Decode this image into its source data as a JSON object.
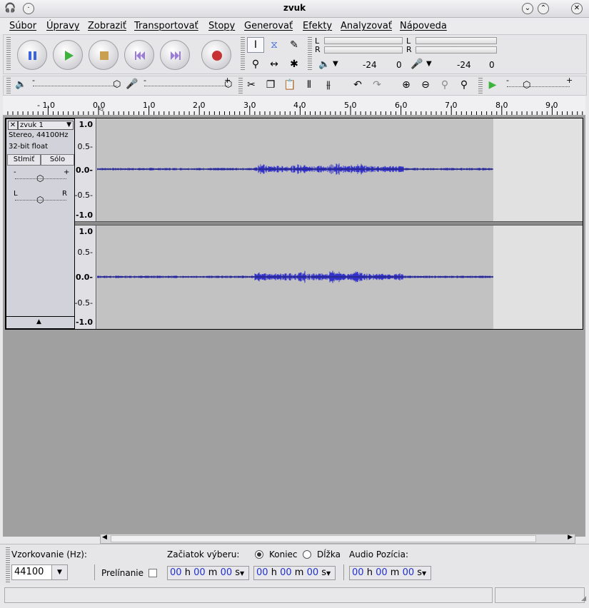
{
  "window": {
    "title": "zvuk"
  },
  "menu": [
    "Súbor",
    "Úpravy",
    "Zobraziť",
    "Transportovať",
    "Stopy",
    "Generovať",
    "Efekty",
    "Analyzovať",
    "Nápoveda"
  ],
  "meters": {
    "play_l": "L",
    "play_r": "R",
    "rec_l": "L",
    "rec_r": "R",
    "play_db_a": "-24",
    "play_db_b": "0",
    "rec_db_a": "-24",
    "rec_db_b": "0"
  },
  "mixer": {
    "minus": "-",
    "plus": "+"
  },
  "ruler": {
    "ticks": [
      "- 1.0",
      "0.0",
      "1.0",
      "2.0",
      "3.0",
      "4.0",
      "5.0",
      "6.0",
      "7.0",
      "8.0",
      "9.0"
    ]
  },
  "track": {
    "name": "zvuk 1",
    "info_format": "Stereo, 44100Hz",
    "info_bits": "32-bit float",
    "mute_label": "Stlmiť",
    "solo_label": "Sólo",
    "gain_minus": "-",
    "gain_plus": "+",
    "pan_left": "L",
    "pan_right": "R",
    "scale": [
      "1.0",
      "0.5-",
      "0.0-",
      "-0.5-",
      "-1.0"
    ]
  },
  "bottom": {
    "rate_label": "Vzorkovanie (Hz):",
    "rate_value": "44100",
    "snap_label": "Prelínanie",
    "sel_start_label": "Začiatok výberu:",
    "end_label": "Koniec",
    "length_label": "Dĺžka",
    "audio_pos_label": "Audio Pozícia:",
    "tc_h": "00",
    "tc_m": "00",
    "tc_s": "00",
    "u_h": "h",
    "u_m": "m",
    "u_s": "s"
  },
  "colors": {
    "waveform": "#3232c8",
    "wave_bg": "#c2c2c2",
    "play": "#3cb43c",
    "record": "#c83232",
    "pause": "#3c64dc"
  }
}
